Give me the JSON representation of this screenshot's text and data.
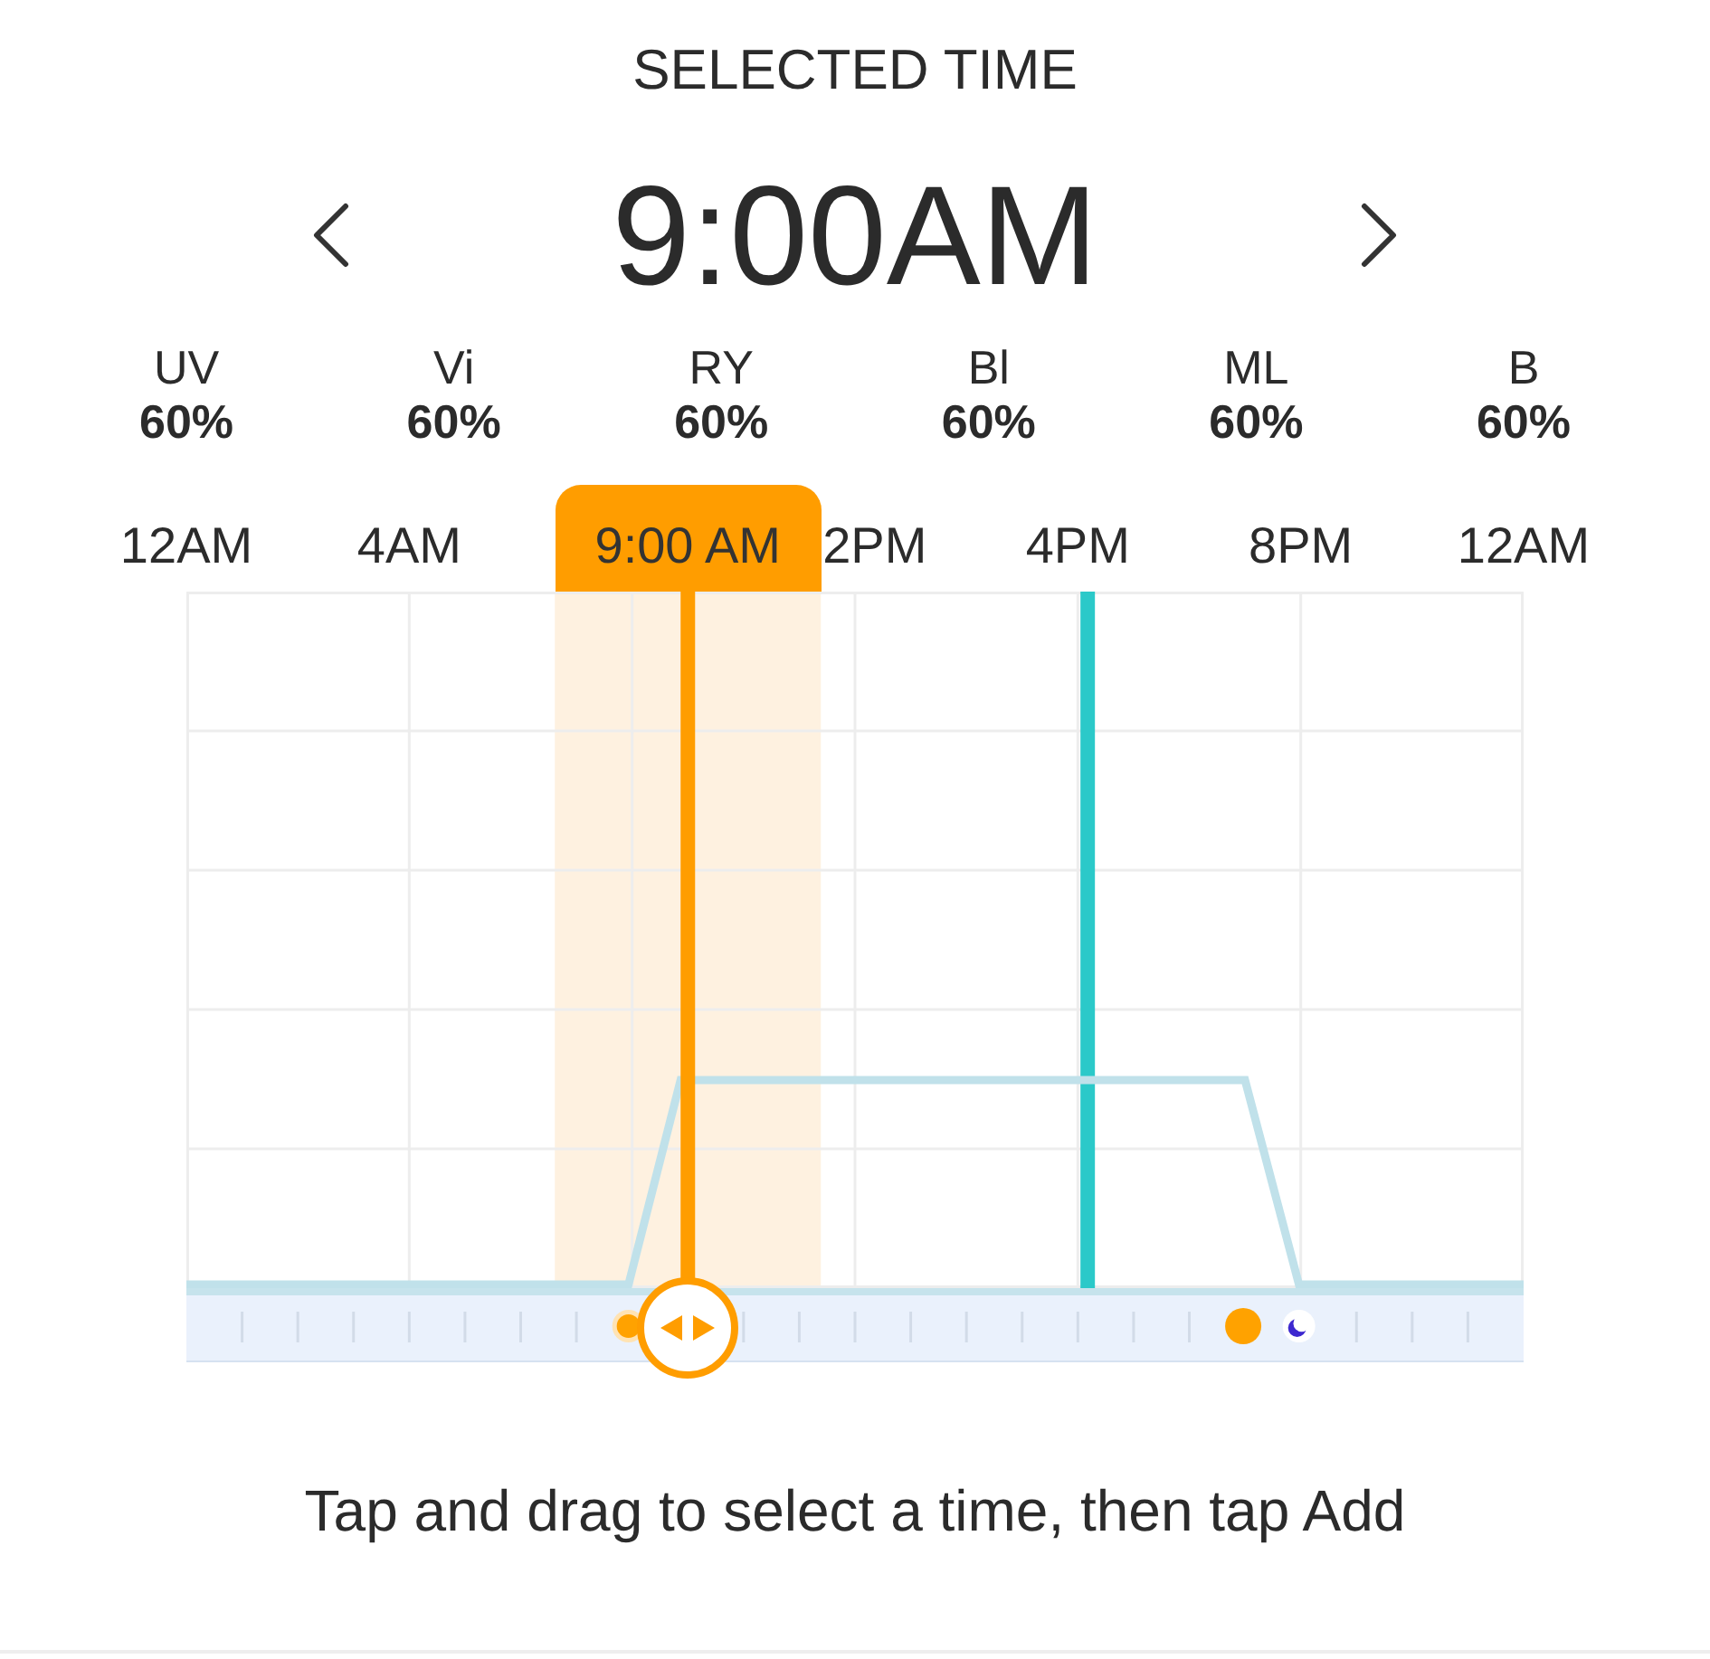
{
  "title": "SELECTED TIME",
  "time_picker": {
    "time": "9:00AM"
  },
  "channels": [
    {
      "name": "UV",
      "value": "60%"
    },
    {
      "name": "Vi",
      "value": "60%"
    },
    {
      "name": "RY",
      "value": "60%"
    },
    {
      "name": "Bl",
      "value": "60%"
    },
    {
      "name": "ML",
      "value": "60%"
    },
    {
      "name": "B",
      "value": "60%"
    }
  ],
  "timeline": {
    "axis_labels": [
      {
        "text": "12AM",
        "covered": false
      },
      {
        "text": "4AM",
        "covered": false
      },
      {
        "text": "2PM",
        "covered": true
      },
      {
        "text": "4PM",
        "covered": false
      },
      {
        "text": "8PM",
        "covered": false
      },
      {
        "text": "12AM",
        "covered": false
      }
    ],
    "playhead": {
      "label": "9:00 AM",
      "level": 0.375
    },
    "now_marker": {
      "level": 0.674
    }
  },
  "hint": "Tap and drag to select a time, then tap Add"
}
